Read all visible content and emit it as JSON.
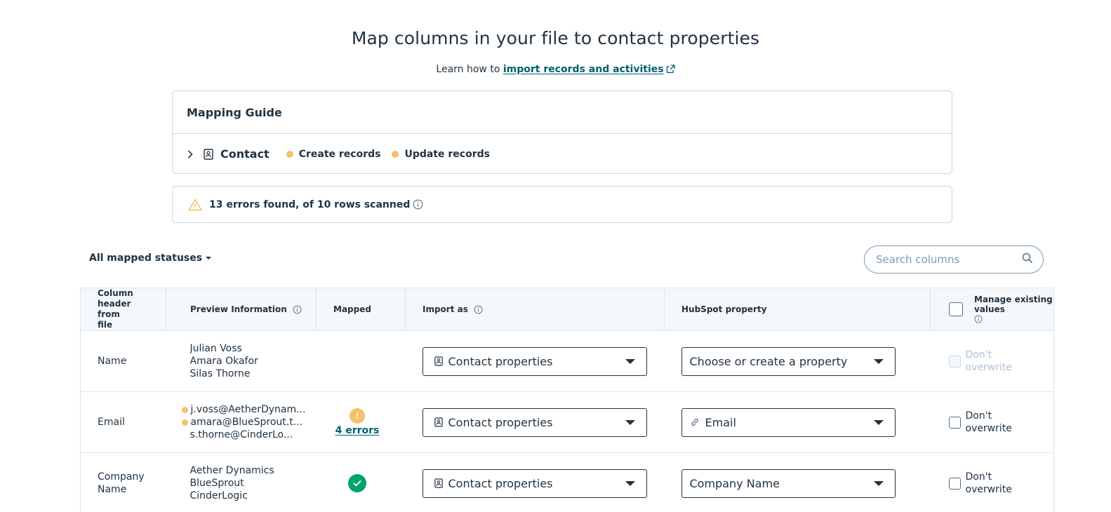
{
  "header": {
    "title": "Map columns in your file to contact properties",
    "learn_prefix": "Learn how to",
    "learn_link": "import records and activities"
  },
  "guide": {
    "title": "Mapping Guide",
    "object_label": "Contact",
    "status_create": "Create records",
    "status_update": "Update records",
    "status_color": "#f5c26b"
  },
  "errors_banner": {
    "text": "13 errors found, of 10 rows scanned"
  },
  "toolbar": {
    "filter_label": "All mapped statuses",
    "search_placeholder": "Search columns"
  },
  "table": {
    "headers": {
      "column_header": "Column header from file",
      "preview": "Preview Information",
      "mapped": "Mapped",
      "import_as": "Import as",
      "hubspot_property": "HubSpot property",
      "manage": "Manage existing values"
    },
    "rows": [
      {
        "column": "Name",
        "preview": [
          "Julian Voss",
          "Amara Okafor",
          "Silas Thorne"
        ],
        "preview_errors": [
          false,
          false,
          false
        ],
        "mapped": "",
        "import_as": "Contact properties",
        "property": "Choose or create a property",
        "property_icon": "",
        "overwrite_label": "Don't overwrite",
        "overwrite_disabled": true
      },
      {
        "column": "Email",
        "preview": [
          "j.voss@AetherDynam...",
          "amara@BlueSprout.t...",
          "s.thorne@CinderLo..."
        ],
        "preview_errors": [
          true,
          true,
          false
        ],
        "mapped": "4 errors",
        "import_as": "Contact properties",
        "property": "Email",
        "property_icon": "link-icon",
        "overwrite_label": "Don't overwrite",
        "overwrite_disabled": false
      },
      {
        "column": "Company Name",
        "preview": [
          "Aether Dynamics",
          "BlueSprout",
          "CinderLogic"
        ],
        "preview_errors": [
          false,
          false,
          false
        ],
        "mapped": "check",
        "import_as": "Contact properties",
        "property": "Company Name",
        "property_icon": "",
        "overwrite_label": "Don't overwrite",
        "overwrite_disabled": false
      }
    ]
  },
  "colors": {
    "link": "#00606e",
    "warning": "#f5c26b",
    "success": "#00a36b",
    "text": "#213343"
  }
}
